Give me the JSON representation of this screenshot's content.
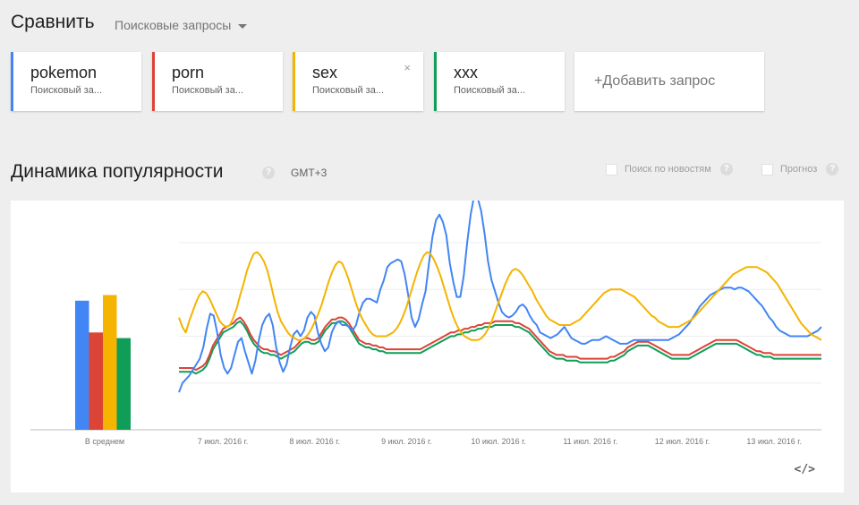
{
  "compare": {
    "title": "Сравнить",
    "mode": "Поисковые запросы"
  },
  "terms": [
    {
      "label": "pokemon",
      "sub": "Поисковый за...",
      "color": "#4285f4"
    },
    {
      "label": "porn",
      "sub": "Поисковый за...",
      "color": "#db4437"
    },
    {
      "label": "sex",
      "sub": "Поисковый за...",
      "color": "#f4b400",
      "close": "×"
    },
    {
      "label": "xxx",
      "sub": "Поисковый за...",
      "color": "#0f9d58"
    }
  ],
  "add_term": "+Добавить запрос",
  "section": {
    "title": "Динамика популярности",
    "help": "?",
    "timezone": "GMT+3"
  },
  "options": {
    "news": "Поиск по новостям",
    "forecast": "Прогноз",
    "help": "?"
  },
  "embed_icon": "</>",
  "chart_data": {
    "type": "line",
    "x_ticks": [
      "7 июл. 2016 г.",
      "8 июл. 2016 г.",
      "9 июл. 2016 г.",
      "10 июл. 2016 г.",
      "11 июл. 2016 г.",
      "12 июл. 2016 г.",
      "13 июл. 2016 г."
    ],
    "average_label": "В среднем",
    "ylim": [
      0,
      100
    ],
    "grid": true,
    "averages": [
      69,
      52,
      72,
      49
    ],
    "series": [
      {
        "name": "pokemon",
        "color": "#4285f4",
        "values": [
          20,
          25,
          27,
          29,
          32,
          35,
          38,
          44,
          54,
          62,
          61,
          52,
          40,
          33,
          30,
          33,
          40,
          47,
          49,
          42,
          36,
          30,
          37,
          48,
          56,
          60,
          62,
          56,
          44,
          36,
          31,
          35,
          44,
          51,
          53,
          50,
          53,
          60,
          63,
          61,
          52,
          46,
          42,
          44,
          52,
          56,
          58,
          56,
          56,
          55,
          53,
          56,
          63,
          68,
          70,
          70,
          69,
          68,
          75,
          80,
          87,
          89,
          90,
          91,
          90,
          83,
          72,
          60,
          55,
          59,
          67,
          74,
          89,
          103,
          112,
          115,
          111,
          104,
          89,
          79,
          71,
          71,
          82,
          100,
          115,
          125,
          124,
          117,
          105,
          90,
          80,
          74,
          68,
          63,
          61,
          60,
          61,
          63,
          66,
          67,
          65,
          61,
          58,
          56,
          52,
          51,
          50,
          49,
          50,
          51,
          53,
          55,
          52,
          49,
          48,
          47,
          46,
          46,
          47,
          48,
          48,
          48,
          49,
          50,
          49,
          48,
          47,
          46,
          46,
          46,
          47,
          48,
          48,
          48,
          48,
          48,
          48,
          48,
          48,
          48,
          48,
          48,
          49,
          50,
          51,
          53,
          55,
          57,
          60,
          63,
          66,
          68,
          70,
          72,
          73,
          74,
          75,
          76,
          76,
          76,
          75,
          76,
          76,
          75,
          74,
          72,
          70,
          68,
          66,
          63,
          60,
          58,
          55,
          53,
          52,
          51,
          50,
          50,
          50,
          50,
          50,
          50,
          51,
          52,
          53,
          55
        ]
      },
      {
        "name": "porn",
        "color": "#db4437",
        "values": [
          33,
          33,
          33,
          33,
          33,
          32,
          33,
          34,
          36,
          40,
          45,
          48,
          51,
          54,
          55,
          56,
          57,
          59,
          60,
          58,
          55,
          51,
          48,
          46,
          44,
          43,
          43,
          42,
          42,
          41,
          40,
          41,
          42,
          43,
          44,
          46,
          48,
          49,
          49,
          48,
          48,
          49,
          52,
          55,
          57,
          59,
          59,
          60,
          60,
          59,
          57,
          54,
          51,
          48,
          47,
          46,
          46,
          45,
          45,
          44,
          44,
          43,
          43,
          43,
          43,
          43,
          43,
          43,
          43,
          43,
          43,
          43,
          44,
          45,
          46,
          47,
          48,
          49,
          50,
          51,
          52,
          52,
          53,
          53,
          54,
          54,
          55,
          55,
          56,
          56,
          57,
          57,
          57,
          58,
          58,
          58,
          58,
          58,
          58,
          57,
          57,
          56,
          55,
          54,
          52,
          50,
          48,
          46,
          44,
          42,
          41,
          40,
          40,
          40,
          39,
          39,
          39,
          39,
          38,
          38,
          38,
          38,
          38,
          38,
          38,
          38,
          38,
          39,
          39,
          40,
          41,
          42,
          44,
          45,
          46,
          47,
          47,
          47,
          47,
          46,
          45,
          44,
          43,
          42,
          41,
          40,
          40,
          40,
          40,
          40,
          40,
          41,
          42,
          43,
          44,
          45,
          46,
          47,
          48,
          48,
          48,
          48,
          48,
          48,
          48,
          47,
          46,
          45,
          44,
          43,
          42,
          42,
          41,
          41,
          41,
          40,
          40,
          40,
          40,
          40,
          40,
          40,
          40,
          40,
          40,
          40,
          40,
          40,
          40,
          40
        ]
      },
      {
        "name": "sex",
        "color": "#f4b400",
        "values": [
          60,
          55,
          52,
          58,
          63,
          68,
          72,
          74,
          73,
          70,
          66,
          62,
          58,
          56,
          55,
          56,
          60,
          65,
          72,
          78,
          85,
          90,
          94,
          95,
          93,
          90,
          85,
          78,
          70,
          63,
          58,
          55,
          52,
          50,
          49,
          48,
          48,
          49,
          51,
          54,
          58,
          62,
          67,
          73,
          79,
          84,
          88,
          90,
          89,
          85,
          80,
          74,
          68,
          63,
          59,
          56,
          53,
          51,
          50,
          50,
          50,
          50,
          51,
          52,
          54,
          57,
          61,
          66,
          72,
          78,
          84,
          89,
          93,
          95,
          94,
          91,
          87,
          82,
          76,
          70,
          64,
          59,
          55,
          52,
          50,
          49,
          48,
          48,
          48,
          49,
          51,
          54,
          58,
          63,
          68,
          73,
          78,
          82,
          85,
          86,
          85,
          83,
          80,
          77,
          74,
          70,
          67,
          64,
          61,
          59,
          58,
          57,
          56,
          56,
          56,
          56,
          57,
          58,
          59,
          61,
          63,
          65,
          67,
          69,
          71,
          73,
          74,
          75,
          75,
          75,
          75,
          74,
          73,
          72,
          71,
          69,
          67,
          65,
          63,
          61,
          60,
          58,
          57,
          56,
          55,
          55,
          55,
          55,
          56,
          57,
          58,
          59,
          61,
          63,
          65,
          67,
          69,
          71,
          73,
          75,
          77,
          79,
          81,
          83,
          84,
          85,
          86,
          87,
          87,
          87,
          87,
          86,
          85,
          84,
          82,
          80,
          78,
          75,
          72,
          69,
          66,
          63,
          60,
          57,
          55,
          53,
          51,
          50,
          49,
          48
        ]
      },
      {
        "name": "xxx",
        "color": "#0f9d58",
        "values": [
          31,
          31,
          31,
          31,
          31,
          30,
          31,
          32,
          34,
          38,
          43,
          46,
          49,
          52,
          53,
          54,
          55,
          57,
          58,
          56,
          53,
          49,
          46,
          44,
          42,
          41,
          41,
          40,
          40,
          39,
          38,
          39,
          40,
          41,
          42,
          44,
          46,
          47,
          47,
          46,
          46,
          47,
          50,
          53,
          55,
          57,
          57,
          58,
          58,
          57,
          55,
          52,
          49,
          46,
          45,
          44,
          44,
          43,
          43,
          42,
          42,
          41,
          41,
          41,
          41,
          41,
          41,
          41,
          41,
          41,
          41,
          41,
          42,
          43,
          44,
          45,
          46,
          47,
          48,
          49,
          50,
          50,
          51,
          51,
          52,
          52,
          53,
          53,
          54,
          54,
          55,
          55,
          55,
          56,
          56,
          56,
          56,
          56,
          56,
          55,
          55,
          54,
          53,
          52,
          50,
          48,
          46,
          44,
          42,
          40,
          39,
          38,
          38,
          38,
          37,
          37,
          37,
          37,
          36,
          36,
          36,
          36,
          36,
          36,
          36,
          36,
          36,
          37,
          37,
          38,
          39,
          40,
          42,
          43,
          44,
          45,
          45,
          45,
          45,
          44,
          43,
          42,
          41,
          40,
          39,
          38,
          38,
          38,
          38,
          38,
          38,
          39,
          40,
          41,
          42,
          43,
          44,
          45,
          46,
          46,
          46,
          46,
          46,
          46,
          46,
          45,
          44,
          43,
          42,
          41,
          40,
          40,
          39,
          39,
          39,
          38,
          38,
          38,
          38,
          38,
          38,
          38,
          38,
          38,
          38,
          38,
          38,
          38,
          38,
          38
        ]
      }
    ]
  }
}
